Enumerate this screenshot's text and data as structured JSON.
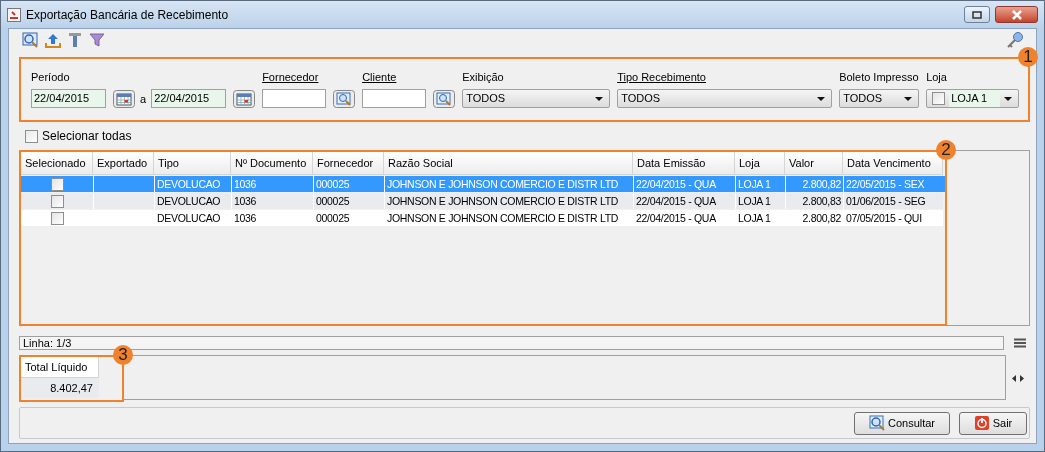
{
  "window": {
    "title": "Exportação Bancária de Recebimento"
  },
  "filters": [
    {
      "kind": "date_range",
      "label": "Período",
      "underlined": false,
      "from": "22/04/2015",
      "connector": "a",
      "to": "22/04/2015"
    },
    {
      "kind": "lookup",
      "label": "Fornecedor",
      "underlined": true
    },
    {
      "kind": "lookup",
      "label": "Cliente",
      "underlined": true
    },
    {
      "kind": "select",
      "label": "Exibição",
      "underlined": false,
      "value": "TODOS"
    },
    {
      "kind": "select",
      "label": "Tipo Recebimento",
      "underlined": true,
      "value": "TODOS"
    },
    {
      "kind": "select",
      "label": "Boleto Impresso",
      "underlined": false,
      "value": "TODOS"
    },
    {
      "kind": "check_select",
      "label": "Loja",
      "underlined": false,
      "value": "LOJA 1",
      "checked": false
    }
  ],
  "select_all": {
    "label": "Selecionar todas",
    "checked": false
  },
  "table": {
    "columns": [
      "Selecionado",
      "Exportado",
      "Tipo",
      "Nº Documento",
      "Fornecedor",
      "Razão Social",
      "Data Emissão",
      "Loja",
      "Valor",
      "Data Vencimento"
    ],
    "rows": [
      {
        "selected": true,
        "checked": false,
        "cells": [
          "",
          "",
          "DEVOLUCAO",
          "1036",
          "000025",
          "JOHNSON E JOHNSON COMERCIO E DISTR LTD",
          "22/04/2015 - QUA",
          "LOJA 1",
          "2.800,82",
          "22/05/2015 - SEX"
        ]
      },
      {
        "selected": false,
        "checked": false,
        "cells": [
          "",
          "",
          "DEVOLUCAO",
          "1036",
          "000025",
          "JOHNSON E JOHNSON COMERCIO E DISTR LTD",
          "22/04/2015 - QUA",
          "LOJA 1",
          "2.800,83",
          "01/06/2015 - SEG"
        ]
      },
      {
        "selected": false,
        "checked": false,
        "cells": [
          "",
          "",
          "DEVOLUCAO",
          "1036",
          "000025",
          "JOHNSON E JOHNSON COMERCIO E DISTR LTD",
          "22/04/2015 - QUA",
          "LOJA 1",
          "2.800,82",
          "07/05/2015 - QUI"
        ]
      }
    ]
  },
  "status": "Linha: 1/3",
  "totals": {
    "label": "Total Líquido",
    "value": "8.402,47"
  },
  "buttons": [
    {
      "kind": "search",
      "label": "Consultar"
    },
    {
      "kind": "exit",
      "label": "Sair"
    }
  ],
  "callouts": [
    "1",
    "2",
    "3"
  ]
}
